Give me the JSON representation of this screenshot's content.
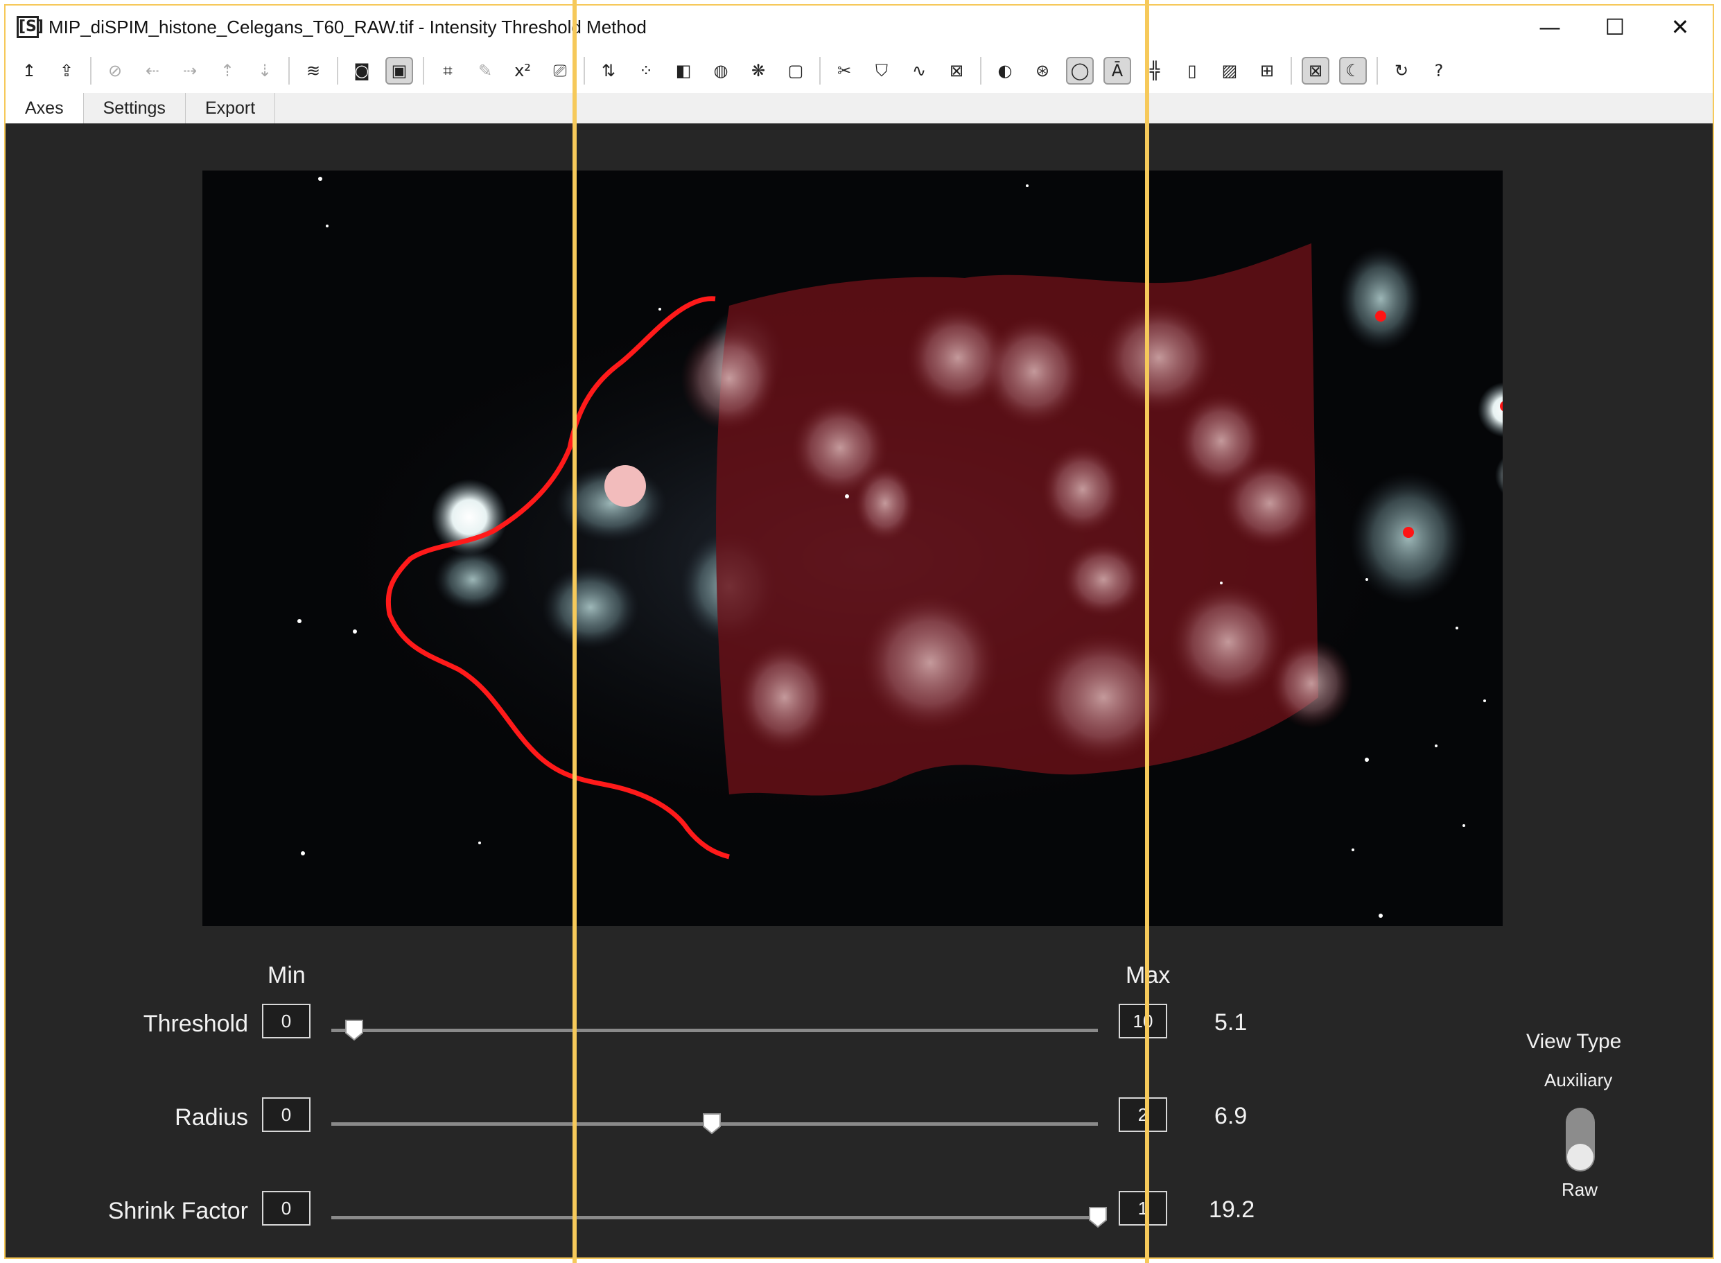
{
  "window": {
    "app_icon": "[S]",
    "title": "MIP_diSPIM_histone_Celegans_T60_RAW.tif - Intensity Threshold Method",
    "minimize": "—",
    "maximize": "☐",
    "close": "✕"
  },
  "toolbar": {
    "icons": [
      "upload-icon",
      "export-icon",
      "compass-icon",
      "horizontal-flip-icon",
      "horizontal-stretch-icon",
      "vertical-flip-icon",
      "vertical-stretch-icon",
      "layers-icon",
      "frame-icon",
      "frame-select-icon",
      "crop-icon",
      "pen-icon",
      "power-icon",
      "adjust-icon",
      "sort-icon",
      "scatter-icon",
      "split-icon",
      "rotate-icon",
      "brain-icon",
      "boundary-icon",
      "tools-icon",
      "shield-icon",
      "signal-icon",
      "stamp-icon",
      "palette-icon",
      "venn-icon",
      "circle-select-icon",
      "text-select-icon",
      "crosshair-icon",
      "bracket-icon",
      "image-icon",
      "grid-icon",
      "close-box-icon",
      "moon-icon",
      "refresh-icon",
      "help-icon"
    ],
    "glyphs": [
      "↥",
      "⇪",
      "⊘",
      "⇠",
      "⇢",
      "⇡",
      "⇣",
      "≋",
      "◙",
      "▣",
      "⌗",
      "✎",
      "x²",
      "⎚",
      "⇅",
      "⁘",
      "◧",
      "◍",
      "❋",
      "▢",
      "✂",
      "⛉",
      "∿",
      "⊠",
      "◐",
      "⊛",
      "◯",
      "Ā",
      "╬",
      "▯",
      "▨",
      "⊞",
      "⊠",
      "☾",
      "↻",
      "?"
    ]
  },
  "tabs": [
    "Axes",
    "Settings",
    "Export"
  ],
  "selected_tab": "Axes",
  "controls": {
    "min_label": "Min",
    "max_label": "Max",
    "threshold": {
      "label": "Threshold",
      "min": "0",
      "max": "10",
      "value": "5.1",
      "position": 0.03
    },
    "radius": {
      "label": "Radius",
      "min": "0",
      "max": "2",
      "value": "6.9",
      "position": 0.496
    },
    "shrink": {
      "label": "Shrink Factor",
      "min": "0",
      "max": "1",
      "value": "19.2",
      "position": 1.0
    }
  },
  "view_type": {
    "title": "View Type",
    "option_top": "Auxiliary",
    "option_bottom": "Raw",
    "selected": "Raw"
  },
  "colors": {
    "background": "#262626",
    "overlay": "#7a1418",
    "outline": "#ff1a1a",
    "guide": "#f6c95a"
  }
}
